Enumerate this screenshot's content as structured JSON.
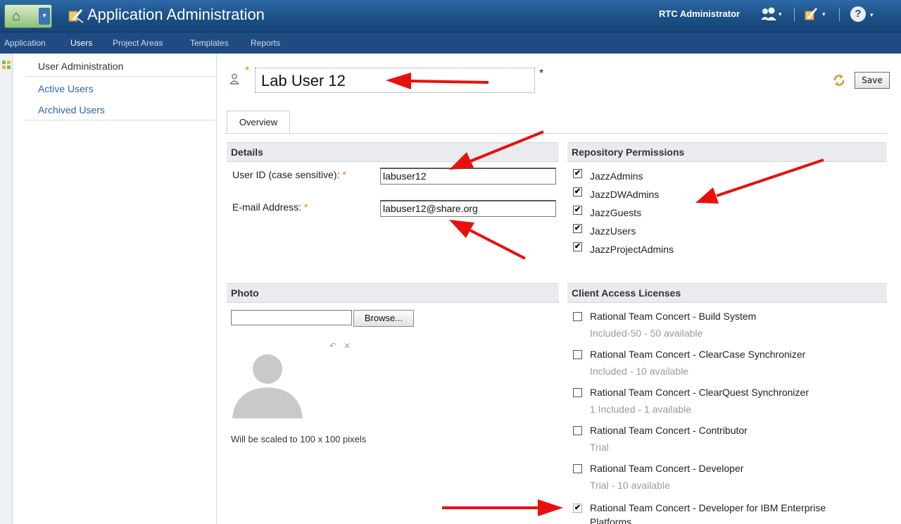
{
  "header": {
    "title": "Application Administration",
    "user": "RTC Administrator",
    "home_icon": "home-icon",
    "help_label": "?"
  },
  "nav": {
    "items": [
      "Application",
      "Users",
      "Project Areas",
      "Templates",
      "Reports"
    ],
    "active": "Users"
  },
  "sidebar": {
    "heading": "User Administration",
    "links": [
      "Active Users",
      "Archived Users"
    ]
  },
  "user": {
    "display_name": "Lab User 12",
    "required_marker": "*"
  },
  "toolbar": {
    "save_label": "Save"
  },
  "tabs": [
    "Overview"
  ],
  "details": {
    "title": "Details",
    "user_id_label": "User ID (case sensitive):",
    "user_id_value": "labuser12",
    "email_label": "E-mail Address:",
    "email_value": "labuser12@share.org",
    "required_marker": "*"
  },
  "repository_permissions": {
    "title": "Repository Permissions",
    "items": [
      {
        "label": "JazzAdmins",
        "checked": true
      },
      {
        "label": "JazzDWAdmins",
        "checked": true
      },
      {
        "label": "JazzGuests",
        "checked": true
      },
      {
        "label": "JazzUsers",
        "checked": true
      },
      {
        "label": "JazzProjectAdmins",
        "checked": true
      }
    ]
  },
  "photo": {
    "title": "Photo",
    "browse_label": "Browse...",
    "note": "Will be scaled to 100 x 100 pixels"
  },
  "licenses": {
    "title": "Client Access Licenses",
    "items": [
      {
        "label": "Rational Team Concert - Build System",
        "sub": "Included-50 - 50 available",
        "checked": false
      },
      {
        "label": "Rational Team Concert - ClearCase Synchronizer",
        "sub": "Included - 10 available",
        "checked": false
      },
      {
        "label": "Rational Team Concert - ClearQuest Synchronizer",
        "sub": "1 Included - 1 available",
        "checked": false
      },
      {
        "label": "Rational Team Concert - Contributor",
        "sub": "Trial",
        "checked": false
      },
      {
        "label": "Rational Team Concert - Developer",
        "sub": "Trial - 10 available",
        "checked": false
      },
      {
        "label": "Rational Team Concert - Developer for IBM Enterprise",
        "label2": "Platforms",
        "checked": true
      }
    ]
  },
  "colors": {
    "header_blue": "#1b4f86",
    "nav_blue": "#1f4b82",
    "link_blue": "#2a63a8",
    "required_orange": "#e87a15",
    "annotation_red": "#e8100e"
  }
}
